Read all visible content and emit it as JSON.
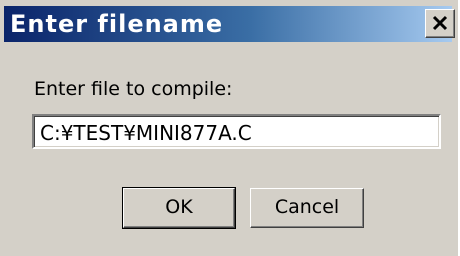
{
  "dialog": {
    "title": "Enter filename",
    "close_icon": "close-icon",
    "prompt": "Enter file to compile:",
    "input_value": "C:¥TEST¥MINI877A.C",
    "ok_label": "OK",
    "cancel_label": "Cancel"
  },
  "colors": {
    "title_gradient_start": "#0a246a",
    "title_gradient_end": "#a6caf0",
    "dialog_background": "#d4d0c8"
  }
}
